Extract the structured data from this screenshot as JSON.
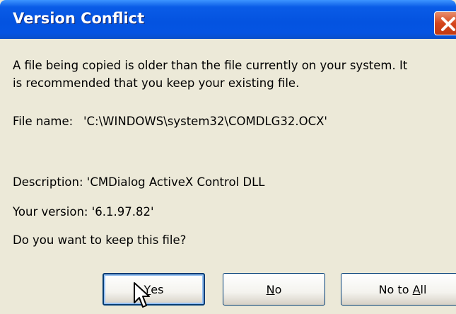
{
  "window": {
    "title": "Version Conflict",
    "close_icon": "close-icon"
  },
  "message": {
    "line1": "A file being copied is older than the file currently on your system.  It",
    "line2": "is recommended that you keep your existing file."
  },
  "file_name": {
    "label": "File name:",
    "value": "'C:\\WINDOWS\\system32\\COMDLG32.OCX'"
  },
  "description": {
    "label": "Description:",
    "value": "'CMDialog ActiveX Control DLL"
  },
  "version": {
    "label": "Your version:",
    "value": "'6.1.97.82'"
  },
  "question": "Do you want to keep this file?",
  "buttons": {
    "yes": {
      "prefix": "",
      "accel": "Y",
      "rest": "es"
    },
    "no": {
      "prefix": "",
      "accel": "N",
      "rest": "o"
    },
    "no_to_all": {
      "prefix": "No to ",
      "accel": "A",
      "rest": "ll"
    }
  },
  "colors": {
    "titlebar": "#0453e0",
    "dialog_bg": "#ece9d8",
    "close_button": "#d5451c"
  }
}
